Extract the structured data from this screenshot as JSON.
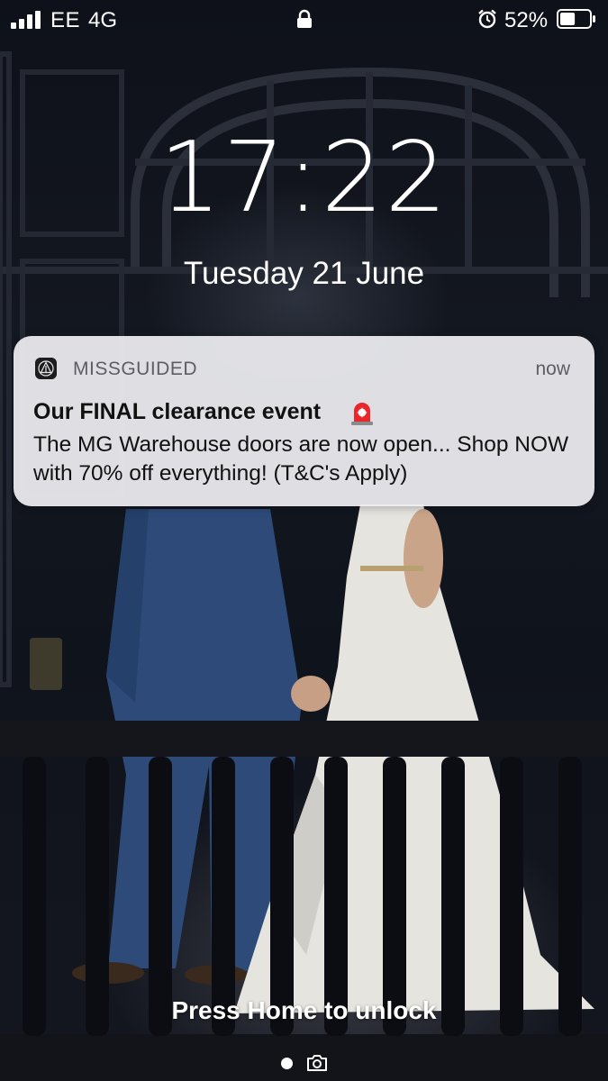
{
  "status_bar": {
    "carrier": "EE",
    "network": "4G",
    "battery_percent": "52%",
    "battery_level": 0.52,
    "signal_bars": 4,
    "icons": [
      "signal-icon",
      "lock-icon",
      "alarm-icon",
      "battery-icon"
    ]
  },
  "lock_screen": {
    "time": "17:22",
    "date": "Tuesday 21 June",
    "unlock_hint": "Press Home to unlock"
  },
  "notification": {
    "app_name": "MISSGUIDED",
    "time": "now",
    "title": "Our FINAL clearance event",
    "title_emoji_icon": "siren-icon",
    "body": "The MG Warehouse doors are now open... Shop NOW with 70% off everything! (T&C's Apply)"
  },
  "bottom_bar": {
    "icons": [
      "page-dot",
      "camera-icon"
    ]
  },
  "colors": {
    "notification_bg": "#EEEEF2",
    "text_primary": "#111111",
    "text_secondary": "#5D5D63",
    "siren_red": "#E8262B"
  }
}
